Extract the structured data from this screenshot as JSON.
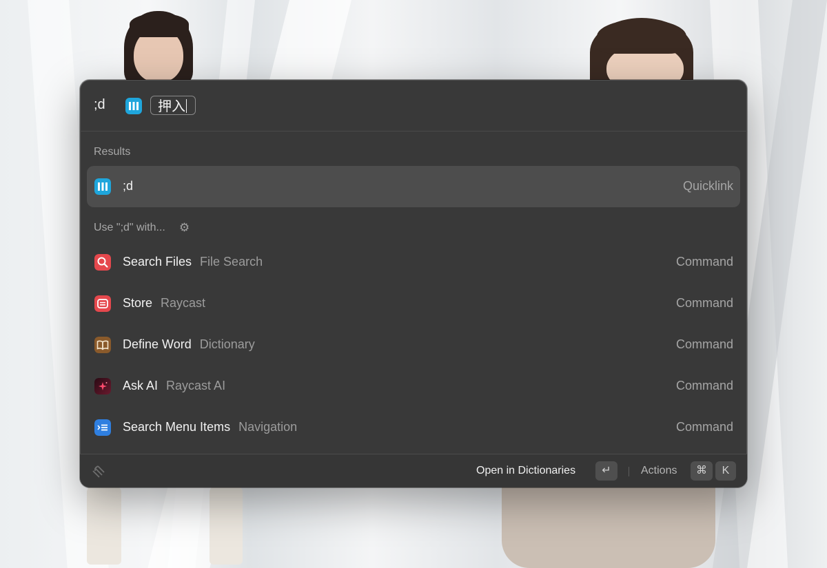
{
  "search": {
    "keyword": ";d",
    "argument": "押入"
  },
  "sections": {
    "results": "Results",
    "use_with": "Use \";d\" with..."
  },
  "results": [
    {
      "title": ";d",
      "subtitle": "",
      "accessory": "Quicklink",
      "icon": "quicklink-icon",
      "selected": true
    }
  ],
  "commands": [
    {
      "title": "Search Files",
      "subtitle": "File Search",
      "accessory": "Command",
      "icon": "search-files-icon",
      "color": "#e5484d"
    },
    {
      "title": "Store",
      "subtitle": "Raycast",
      "accessory": "Command",
      "icon": "store-icon",
      "color": "#e5484d"
    },
    {
      "title": "Define Word",
      "subtitle": "Dictionary",
      "accessory": "Command",
      "icon": "dictionary-icon",
      "color": "#8a5a2b"
    },
    {
      "title": "Ask AI",
      "subtitle": "Raycast AI",
      "accessory": "Command",
      "icon": "ai-sparkle-icon",
      "color": "#5a1020"
    },
    {
      "title": "Search Menu Items",
      "subtitle": "Navigation",
      "accessory": "Command",
      "icon": "menu-items-icon",
      "color": "#2f7fe0"
    }
  ],
  "footer": {
    "primary_action": "Open in Dictionaries",
    "return_key": "↵",
    "actions_label": "Actions",
    "cmd_key": "⌘",
    "k_key": "K"
  },
  "colors": {
    "window_bg": "#393939",
    "selected_row": "#4d4d4d",
    "quicklink_icon": "#1fa6dc"
  }
}
